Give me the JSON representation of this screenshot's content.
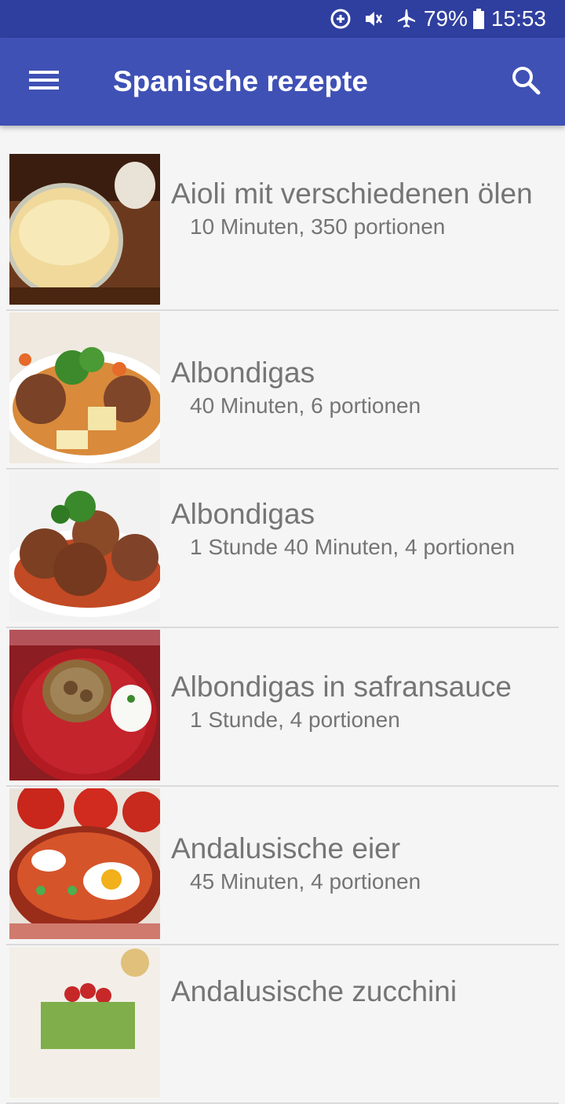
{
  "status_bar": {
    "battery_percent": "79%",
    "time": "15:53",
    "icons": [
      "data-saver-icon",
      "mute-icon",
      "airplane-mode-icon",
      "battery-icon"
    ]
  },
  "app_bar": {
    "title": "Spanische rezepte",
    "menu_icon": "hamburger-menu-icon",
    "search_icon": "search-icon"
  },
  "recipes": [
    {
      "name": "Aioli mit verschiedenen ölen",
      "meta": "10 Minuten, 350 portionen",
      "image": "aioli-jar"
    },
    {
      "name": "Albondigas",
      "meta": "40 Minuten, 6 portionen",
      "image": "meatball-soup"
    },
    {
      "name": "Albondigas",
      "meta": "1 Stunde 40 Minuten, 4 portionen",
      "image": "meatballs-sauce"
    },
    {
      "name": "Albondigas in safransauce",
      "meta": "1 Stunde, 4 portionen",
      "image": "saffron-plate"
    },
    {
      "name": "Andalusische eier",
      "meta": "45 Minuten, 4 portionen",
      "image": "eggs-pan"
    },
    {
      "name": "Andalusische zucchini",
      "meta": "",
      "image": "zucchini"
    }
  ]
}
